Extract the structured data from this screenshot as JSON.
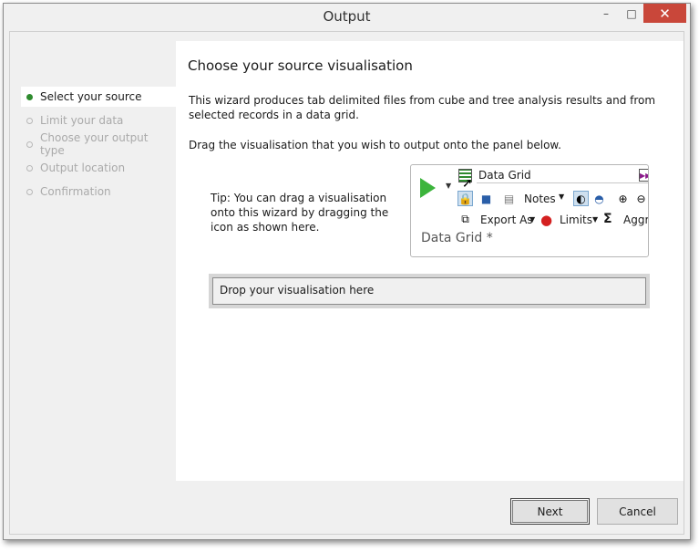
{
  "window": {
    "title": "Output",
    "controls": {
      "minimize": "–",
      "maximize": "□",
      "close": "✕"
    }
  },
  "steps": [
    {
      "label": "Select your source",
      "active": true
    },
    {
      "label": "Limit your data",
      "active": false
    },
    {
      "label": "Choose your output type",
      "active": false
    },
    {
      "label": "Output location",
      "active": false
    },
    {
      "label": "Confirmation",
      "active": false
    }
  ],
  "main": {
    "heading": "Choose your source visualisation",
    "intro": "This wizard produces tab delimited files from cube and tree analysis results and from selected records in a data grid.",
    "instruction": "Drag the visualisation that you wish to output onto the panel below.",
    "tip": "Tip: You can drag a visualisation onto this wizard by dragging the icon as shown here."
  },
  "preview": {
    "grid_label": "Data Grid",
    "notes_label": "Notes",
    "export_label": "Export As",
    "limits_label": "Limits",
    "sigma": "Σ",
    "aggr_label": "Aggr",
    "name": "Data Grid *"
  },
  "dropzone": {
    "label": "Drop your visualisation here"
  },
  "buttons": {
    "next": "Next",
    "cancel": "Cancel"
  },
  "colors": {
    "accent_green": "#2e8b2e",
    "close_red": "#c9473a"
  }
}
